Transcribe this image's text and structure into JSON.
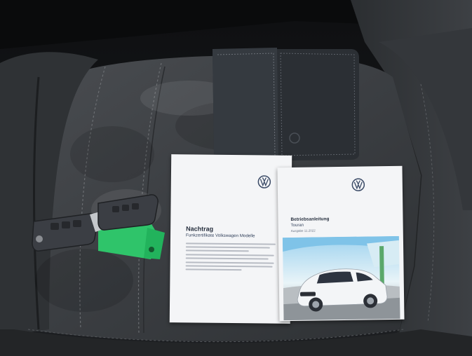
{
  "photo": {
    "subject": "VW car documents and keys on a grey fabric car seat"
  },
  "booklet_left": {
    "title": "Nachtrag",
    "subtitle": "Funkzertifikate Volkswagen Modelle"
  },
  "booklet_right": {
    "title": "Betriebsanleitung",
    "model": "Touran",
    "edition": "Ausgabe 11.2022"
  },
  "colors": {
    "seat": "#3d4043",
    "seat_dark": "#232527",
    "wallet": "#2f3338",
    "paper": "#f4f5f7",
    "vw_logo": "#3a4a66",
    "tag": "#2fc46a",
    "key": "#3b3e44"
  }
}
